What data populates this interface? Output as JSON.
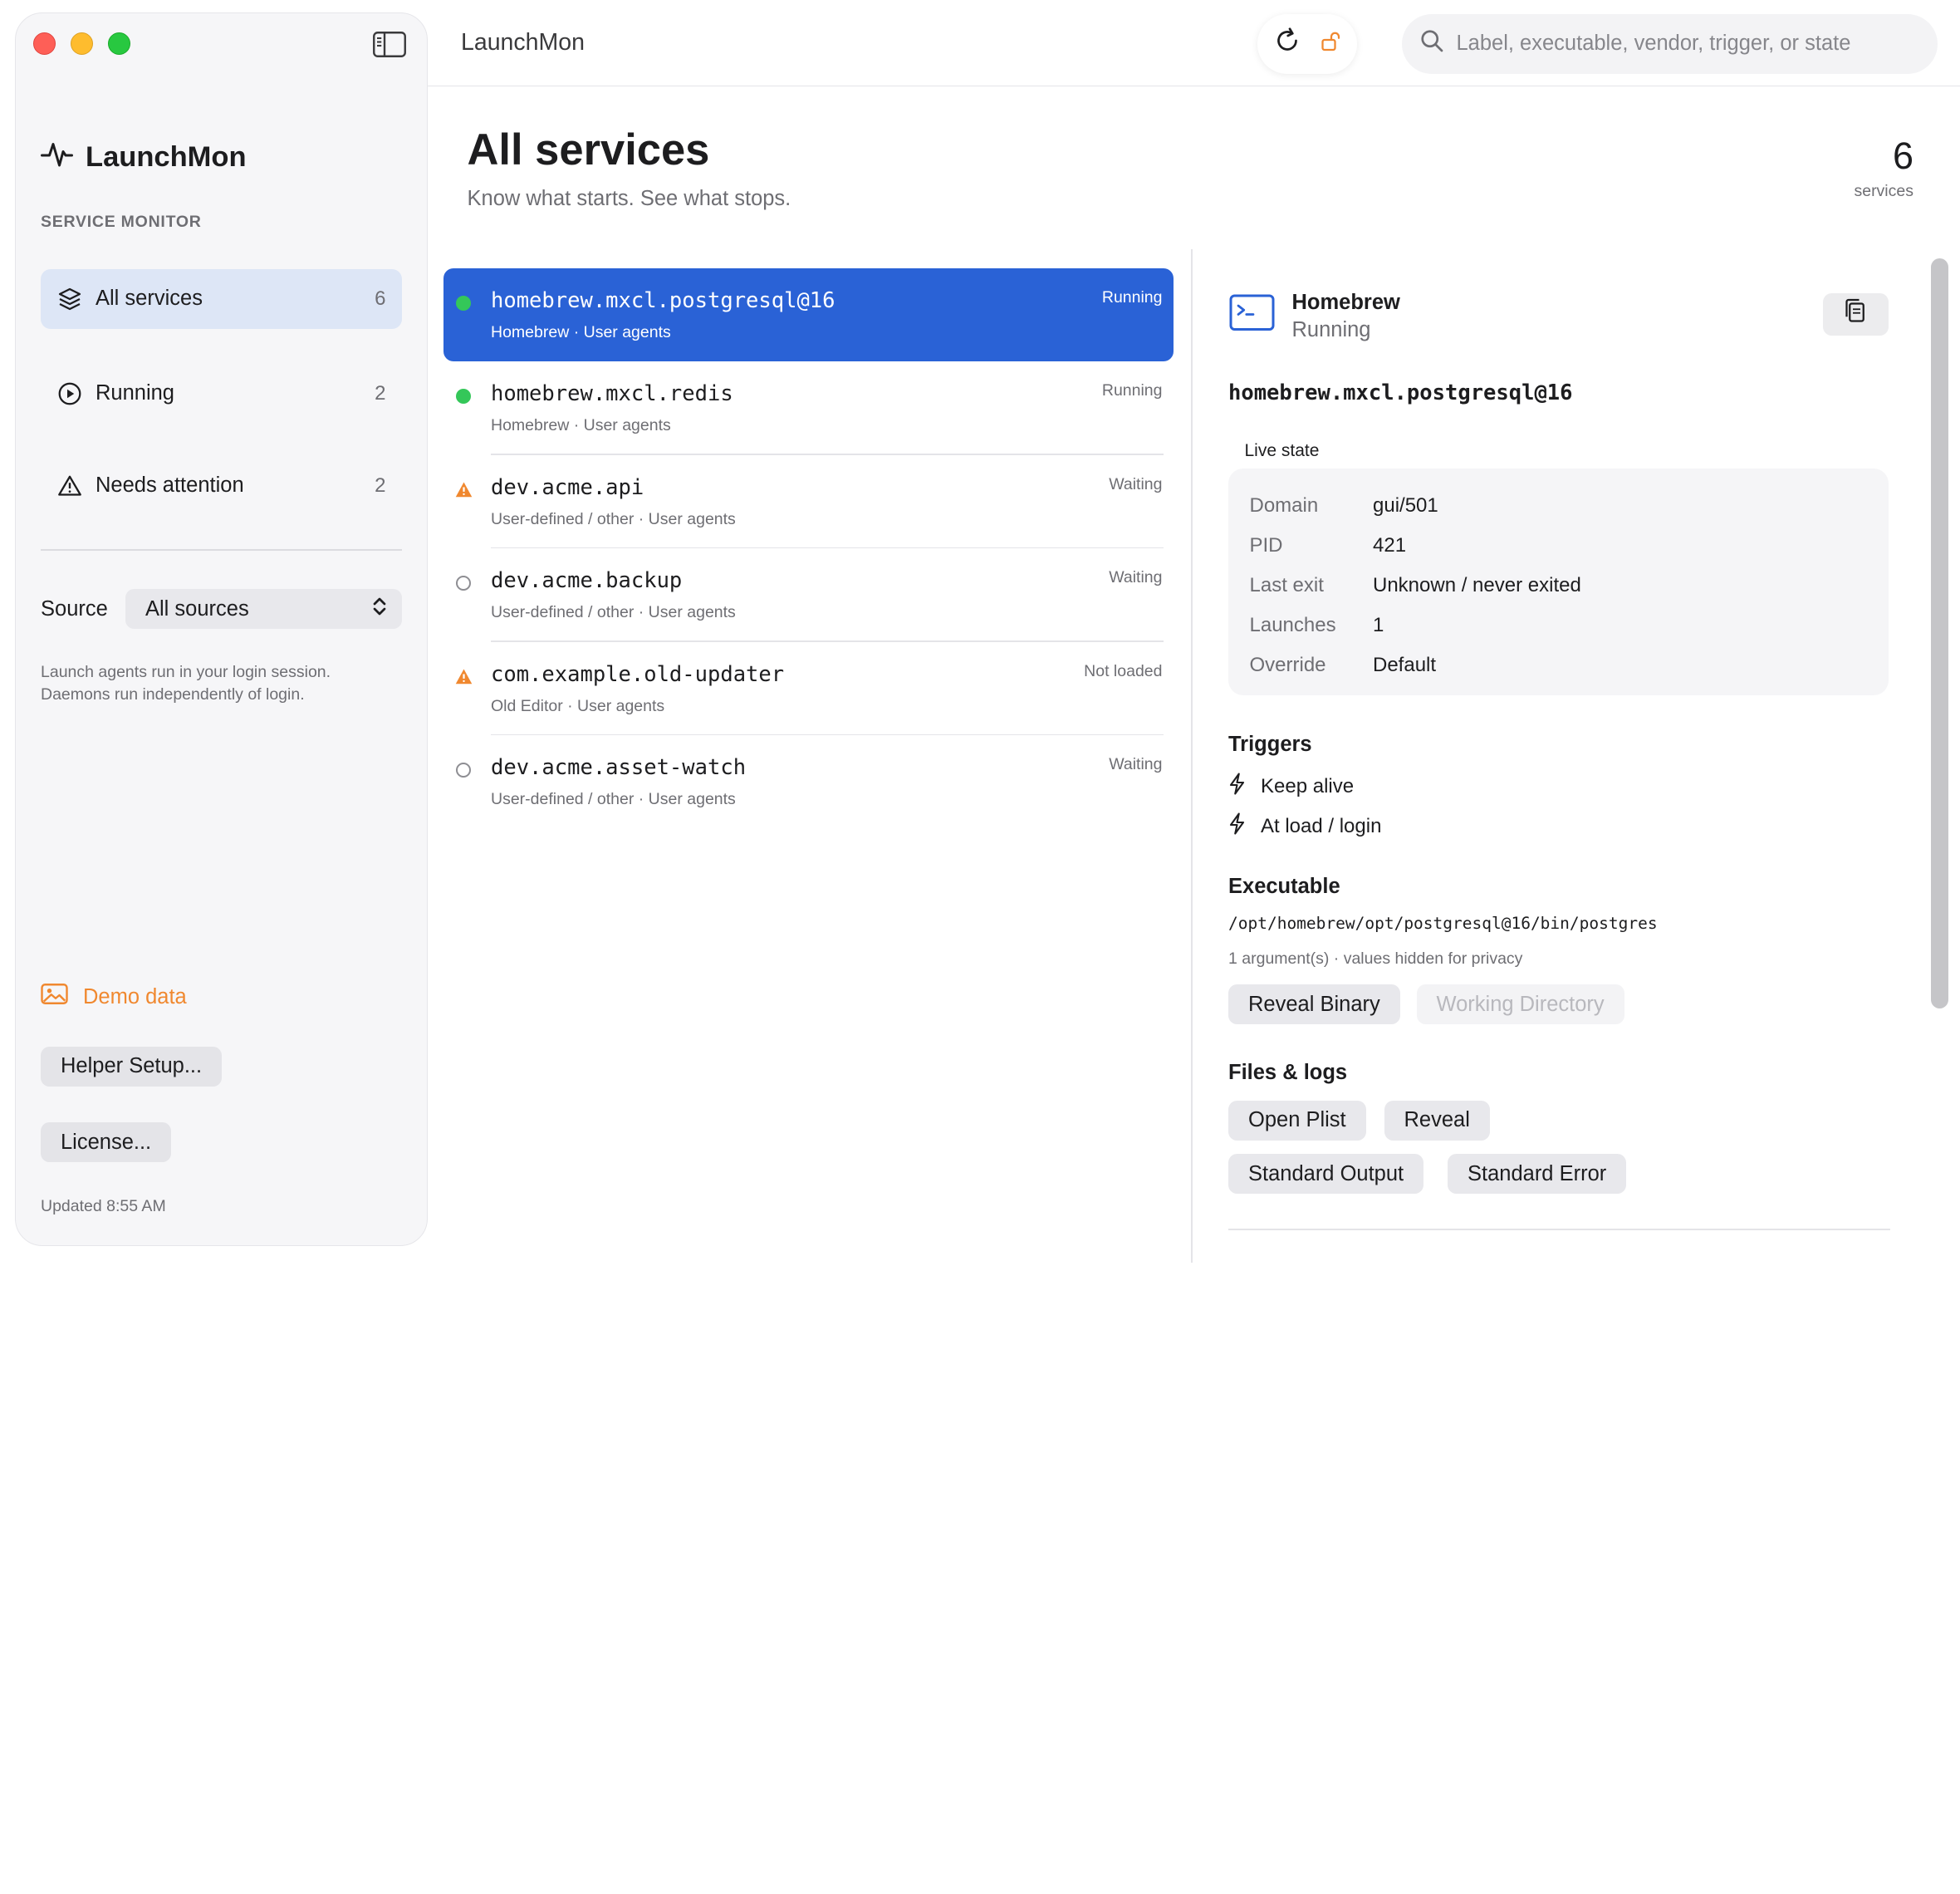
{
  "window": {
    "title": "LaunchMon"
  },
  "toolbar": {
    "refresh_icon": "refresh-icon",
    "lock_icon": "unlock-icon",
    "search_placeholder": "Label, executable, vendor, trigger, or state",
    "search_value": ""
  },
  "sidebar": {
    "brand": "LaunchMon",
    "brand_icon": "pulse-icon",
    "section_label": "SERVICE MONITOR",
    "items": [
      {
        "label": "All services",
        "count": "6",
        "icon": "stack-icon",
        "active": true
      },
      {
        "label": "Running",
        "count": "2",
        "icon": "play-circle-icon",
        "active": false
      },
      {
        "label": "Needs attention",
        "count": "2",
        "icon": "warning-icon",
        "active": false
      }
    ],
    "source_label": "Source",
    "source_value": "All sources",
    "source_note": "Launch agents run in your login session. Daemons run independently of login.",
    "demo_label": "Demo data",
    "helper_button": "Helper Setup...",
    "license_button": "License...",
    "updated": "Updated 8:55 AM"
  },
  "main": {
    "title": "All services",
    "subtitle": "Know what starts. See what stops.",
    "count": "6",
    "count_label": "services"
  },
  "services": [
    {
      "label": "homebrew.mxcl.postgresql@16",
      "meta": "Homebrew · User agents",
      "state": "Running",
      "indicator": "green-dot",
      "selected": true
    },
    {
      "label": "homebrew.mxcl.redis",
      "meta": "Homebrew · User agents",
      "state": "Running",
      "indicator": "green-dot",
      "selected": false
    },
    {
      "label": "dev.acme.api",
      "meta": "User-defined / other · User agents",
      "state": "Waiting",
      "indicator": "warning",
      "selected": false
    },
    {
      "label": "dev.acme.backup",
      "meta": "User-defined / other · User agents",
      "state": "Waiting",
      "indicator": "empty-circle",
      "selected": false
    },
    {
      "label": "com.example.old-updater",
      "meta": "Old Editor · User agents",
      "state": "Not loaded",
      "indicator": "warning",
      "selected": false
    },
    {
      "label": "dev.acme.asset-watch",
      "meta": "User-defined / other · User agents",
      "state": "Waiting",
      "indicator": "empty-circle",
      "selected": false
    }
  ],
  "detail": {
    "vendor": "Homebrew",
    "status": "Running",
    "label": "homebrew.mxcl.postgresql@16",
    "live_state_title": "Live state",
    "live_state": [
      {
        "key": "Domain",
        "value": "gui/501"
      },
      {
        "key": "PID",
        "value": "421"
      },
      {
        "key": "Last exit",
        "value": "Unknown / never exited"
      },
      {
        "key": "Launches",
        "value": "1"
      },
      {
        "key": "Override",
        "value": "Default"
      }
    ],
    "triggers_title": "Triggers",
    "triggers": [
      "Keep alive",
      "At load / login"
    ],
    "executable_title": "Executable",
    "executable_path": "/opt/homebrew/opt/postgresql@16/bin/postgres",
    "executable_note": "1 argument(s) · values hidden for privacy",
    "reveal_binary": "Reveal Binary",
    "working_directory": "Working Directory",
    "files_title": "Files & logs",
    "open_plist": "Open Plist",
    "reveal": "Reveal",
    "stdout": "Standard Output",
    "stderr": "Standard Error"
  },
  "colors": {
    "accent": "#2a62d6",
    "selection_bg": "#dde6f6",
    "running": "#34c759",
    "warning": "#f0882f"
  }
}
